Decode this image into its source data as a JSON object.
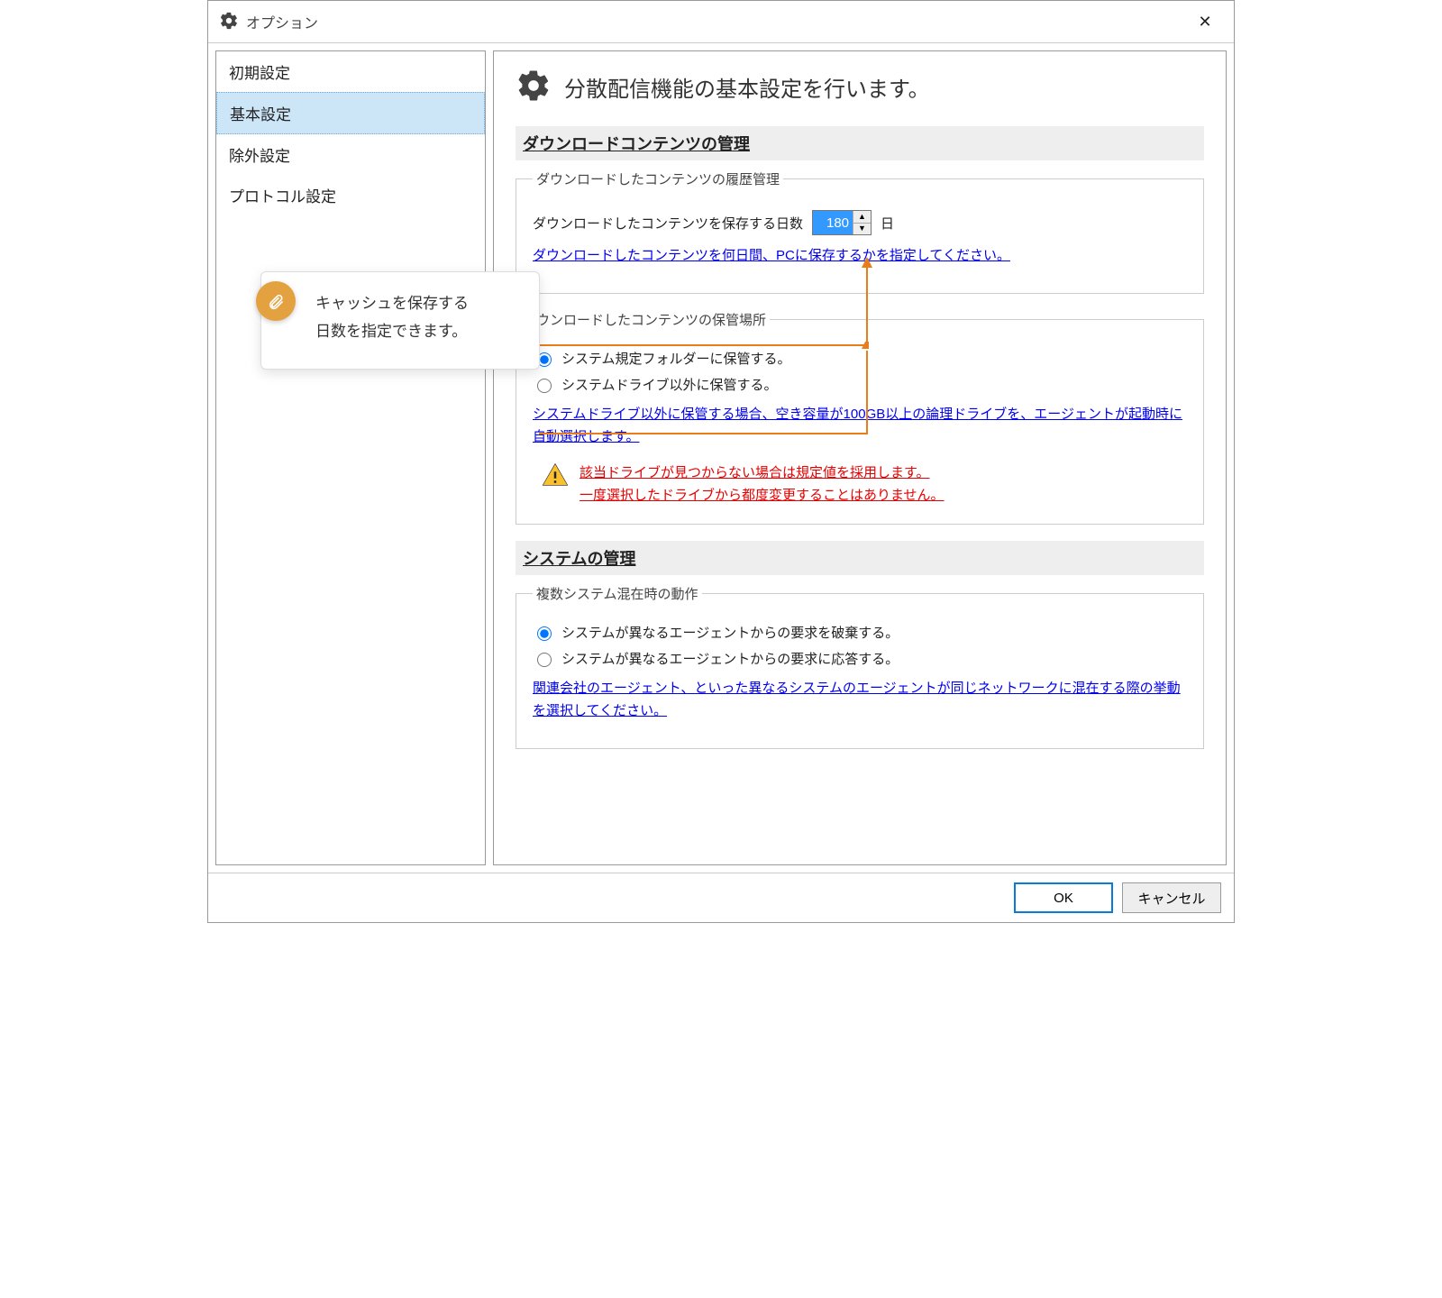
{
  "window": {
    "title": "オプション"
  },
  "sidebar": {
    "items": [
      {
        "label": "初期設定"
      },
      {
        "label": "基本設定",
        "selected": true
      },
      {
        "label": "除外設定"
      },
      {
        "label": "プロトコル設定"
      }
    ]
  },
  "page": {
    "title": "分散配信機能の基本設定を行います。"
  },
  "section1": {
    "heading": "ダウンロードコンテンツの管理",
    "fieldset1": {
      "legend": "ダウンロードしたコンテンツの履歴管理",
      "days_label": "ダウンロードしたコンテンツを保存する日数",
      "days_value": "180",
      "days_unit": "日",
      "hint": "ダウンロードしたコンテンツを何日間、PCに保存するかを指定してください。"
    },
    "fieldset2": {
      "legend": "ウンロードしたコンテンツの保管場所",
      "radio1": "システム規定フォルダーに保管する。",
      "radio2": "システムドライブ以外に保管する。",
      "hint": "システムドライブ以外に保管する場合、空き容量が100GB以上の論理ドライブを、エージェントが起動時に自動選択します。",
      "warn1": "該当ドライブが見つからない場合は規定値を採用します。",
      "warn2": "一度選択したドライブから都度変更することはありません。"
    }
  },
  "section2": {
    "heading": "システムの管理",
    "fieldset1": {
      "legend": "複数システム混在時の動作",
      "radio1": "システムが異なるエージェントからの要求を破棄する。",
      "radio2": "システムが異なるエージェントからの要求に応答する。",
      "hint": "関連会社のエージェント、といった異なるシステムのエージェントが同じネットワークに混在する際の挙動を選択してください。"
    }
  },
  "footer": {
    "ok": "OK",
    "cancel": "キャンセル"
  },
  "callout": {
    "line1": "キャッシュを保存する",
    "line2": "日数を指定できます。"
  }
}
